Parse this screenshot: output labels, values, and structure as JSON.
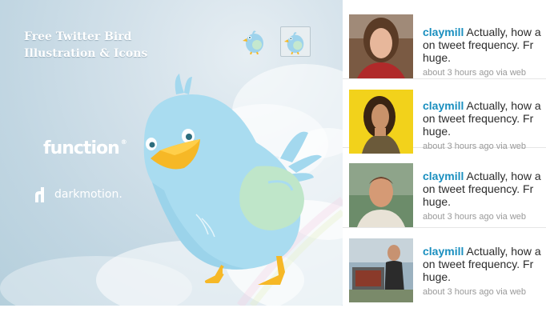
{
  "hero": {
    "title_line1": "Free Twitter Bird",
    "title_line2": "Illustration & Icons",
    "brand_function": "function",
    "brand_function_mark": "®",
    "brand_darkmotion": "darkmotion."
  },
  "icons": {
    "bird_icon_small": "bird-icon",
    "bird_icon_selected": "bird-icon"
  },
  "colors": {
    "username": "#1a8fbf",
    "bird_body": "#a9dcf0",
    "bird_beak": "#f6b826",
    "bird_wing": "#bfe6c9"
  },
  "tweets": [
    {
      "user": "claymill",
      "line1": " Actually, how a",
      "line2": "on tweet frequency. Fr",
      "line3": "huge.",
      "meta": "about 3 hours ago via web"
    },
    {
      "user": "claymill",
      "line1": " Actually, how a",
      "line2": "on tweet frequency. Fr",
      "line3": "huge.",
      "meta": "about 3 hours ago via web"
    },
    {
      "user": "claymill",
      "line1": " Actually, how a",
      "line2": "on tweet frequency. Fr",
      "line3": "huge.",
      "meta": "about 3 hours ago via web"
    },
    {
      "user": "claymill",
      "line1": " Actually, how a",
      "line2": "on tweet frequency. Fr",
      "line3": "huge.",
      "meta": "about 3 hours ago via web"
    }
  ]
}
